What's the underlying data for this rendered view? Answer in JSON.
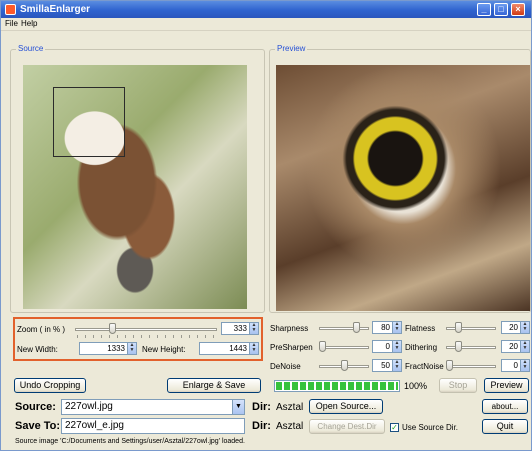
{
  "window": {
    "title": "SmillaEnlarger"
  },
  "menu": [
    "File",
    "Help"
  ],
  "source_panel": {
    "label": "Source"
  },
  "preview_panel": {
    "label": "Preview"
  },
  "zoom": {
    "label": "Zoom ( in % )",
    "value": "333",
    "slider_fraction": 0.25
  },
  "new_width": {
    "label": "New Width:",
    "value": "1333"
  },
  "new_height": {
    "label": "New Height:",
    "value": "1443"
  },
  "params": [
    {
      "label": "Sharpness",
      "value": "80",
      "slider_fraction": 0.8
    },
    {
      "label": "PreSharpen",
      "value": "0",
      "slider_fraction": 0.0
    },
    {
      "label": "DeNoise",
      "value": "50",
      "slider_fraction": 0.5
    },
    {
      "label": "Flatness",
      "value": "20",
      "slider_fraction": 0.2
    },
    {
      "label": "Dithering",
      "value": "20",
      "slider_fraction": 0.2
    },
    {
      "label": "FractNoise",
      "value": "0",
      "slider_fraction": 0.0
    }
  ],
  "progress": {
    "percent_text": "100%",
    "fraction": 1.0
  },
  "buttons": {
    "undo_cropping": "Undo Cropping",
    "enlarge_save": "Enlarge & Save",
    "stop": "Stop",
    "preview": "Preview",
    "open_source": "Open Source...",
    "change_dest_dir": "Change Dest.Dir",
    "about": "about...",
    "quit": "Quit"
  },
  "source": {
    "label": "Source:",
    "value": "227owl.jpg",
    "dir_label": "Dir:",
    "dir_value": "Asztal"
  },
  "save_to": {
    "label": "Save To:",
    "value": "227owl_e.jpg",
    "dir_label": "Dir:",
    "dir_value": "Asztal"
  },
  "use_source_dir": {
    "label": "Use Source Dir.",
    "checked": true
  },
  "status": "Source image 'C:/Documents and Settings/user/Asztal/227owl.jpg' loaded.",
  "colors": {
    "accent": "#2650d6",
    "highlight_border": "#e2612c",
    "progress": "#37c23c"
  },
  "icons": [
    "app-icon",
    "minimize-icon",
    "maximize-icon",
    "close-icon",
    "spin-arrows-icon",
    "dropdown-arrow-icon",
    "checkbox-check-icon"
  ]
}
